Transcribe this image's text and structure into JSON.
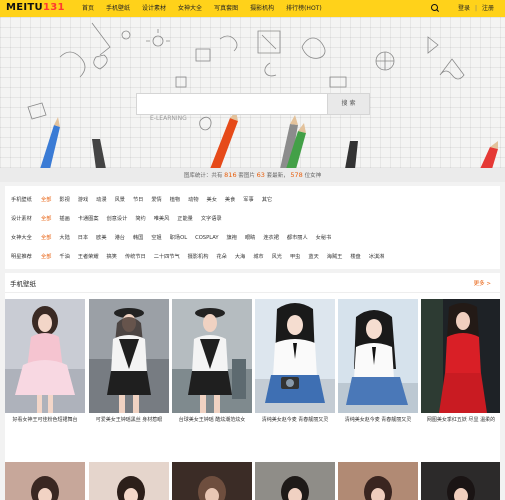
{
  "header": {
    "logo_main": "MEITU",
    "logo_accent": "131",
    "nav": [
      "首页",
      "手机壁纸",
      "设计素材",
      "女神大全",
      "写真套图",
      "摄影机构",
      "排行榜(HOT)"
    ],
    "login": "登录",
    "register": "注册",
    "search_icon": "search-icon",
    "colors": {
      "bar": "#ffd21a",
      "active": "#e7b900",
      "accent": "#e85e0b"
    }
  },
  "banner": {
    "search_button": "搜 索",
    "search_placeholder": "",
    "doodle_text": "E-LEARNING"
  },
  "stats": {
    "prefix": "图库统计：共有",
    "sets": "816",
    "sets_unit": "套图片",
    "images": "63",
    "images_unit": "套最新，",
    "models": "578",
    "models_unit": "位女神"
  },
  "categories": [
    [
      "手机壁纸",
      "全部",
      "影视",
      "游戏",
      "动漫",
      "风景",
      "节日",
      "爱情",
      "植物",
      "动物",
      "美女",
      "美食",
      "军事",
      "其它"
    ],
    [
      "设计素材",
      "全部",
      "插画",
      "卡通图案",
      "创意设计",
      "简约",
      "唯美风",
      "正能量",
      "文字语录"
    ],
    [
      "女神大全",
      "全部",
      "大陆",
      "日本",
      "欧美",
      "港台",
      "韩国",
      "空姐",
      "职场OL",
      "COSPLAY",
      "旗袍",
      "眼睛",
      "连衣裙",
      "都市丽人",
      "女秘书"
    ],
    [
      "明星推荐",
      "全部",
      "千油",
      "王者荣耀",
      "搞笑",
      "传统节日",
      "二十四节气",
      "摄影机构",
      "花朵",
      "大海",
      "城市",
      "风光",
      "甲虫",
      "蓝天",
      "海贼王",
      "楼盘",
      "冰淇淋"
    ]
  ],
  "gallery": {
    "title": "手机壁纸",
    "more": "更多 >",
    "captions": [
      "好看女神王可佳粉色短裙舞台",
      "可爱美女王钟瑶黑丝 身材惹眼",
      "台球美女王钟瑶 酷炫潮范炫女",
      "清纯美女赵今麦 青春靓丽又灵",
      "清纯美女赵今麦 青春靓丽又灵",
      "网图美女季红五妖 尽显 温柔的"
    ]
  }
}
